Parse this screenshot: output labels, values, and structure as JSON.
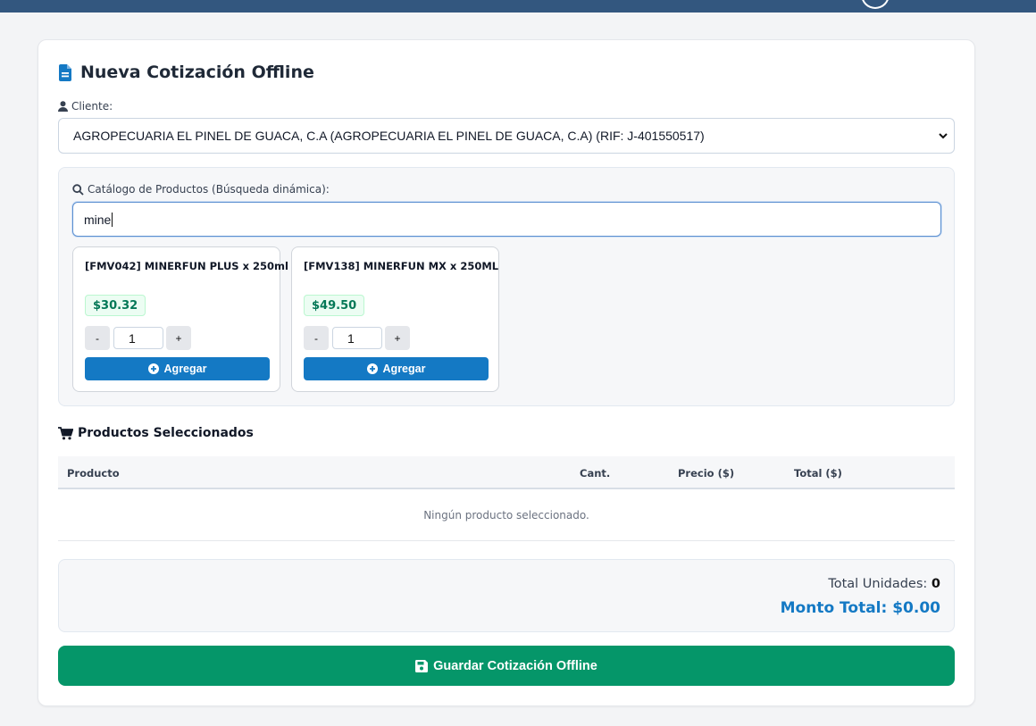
{
  "form": {
    "title": "Nueva Cotización Offline",
    "client_label": "Cliente:",
    "client_selected": "AGROPECUARIA EL PINEL DE GUACA, C.A (AGROPECUARIA EL PINEL DE GUACA, C.A) (RIF: J-401550517)"
  },
  "catalog": {
    "label": "Catálogo de Productos (Búsqueda dinámica):",
    "search_value": "mine",
    "products": [
      {
        "name": "[FMV042] MINERFUN PLUS x 250ml",
        "price": "$30.32",
        "qty": "1",
        "minus": "-",
        "plus": "+",
        "add_label": "Agregar"
      },
      {
        "name": "[FMV138] MINERFUN MX x 250ML",
        "price": "$49.50",
        "qty": "1",
        "minus": "-",
        "plus": "+",
        "add_label": "Agregar"
      }
    ]
  },
  "selected": {
    "title": "Productos Seleccionados",
    "columns": [
      "Producto",
      "Cant.",
      "Precio ($)",
      "Total ($)"
    ],
    "empty_text": "Ningún producto seleccionado."
  },
  "totals": {
    "units_label": "Total Unidades:",
    "units_value": "0",
    "amount_label": "Monto Total:",
    "amount_value": "$0.00"
  },
  "actions": {
    "save_label": "Guardar Cotización Offline"
  },
  "colors": {
    "header": "#33577f",
    "primary": "#1479c4",
    "success": "#059669",
    "price_text": "#047857"
  }
}
